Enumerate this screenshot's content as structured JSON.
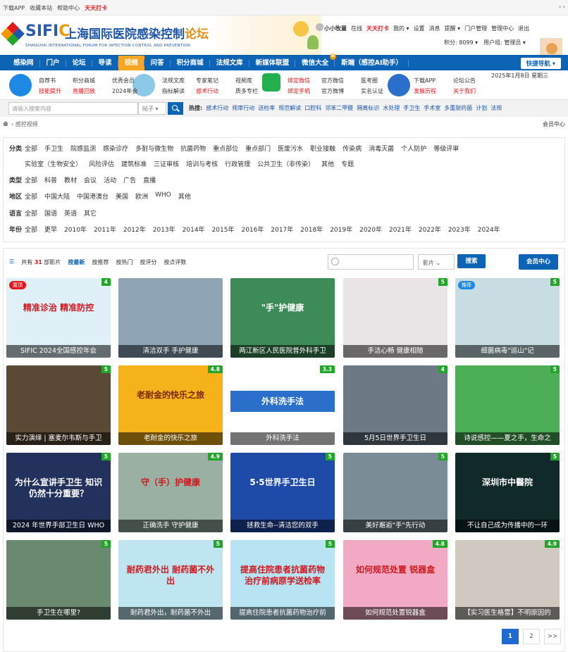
{
  "topbar": {
    "links": [
      "下载APP",
      "收藏本站",
      "帮助中心"
    ],
    "checkin": "天天打卡",
    "arrows": "‹ ›"
  },
  "logo": {
    "brand_a": "SIFI",
    "brand_c": "C",
    "cn_a": "上海国际医院感染控制",
    "cn_b": "论坛",
    "en": "SHANGHAI INTERNATIONAL FORUM FOR INFECTION CONTROL AND PREVENTION"
  },
  "user": {
    "name": "小小牧童",
    "online": "在线",
    "checkin": "天天打卡",
    "links": [
      "我的 ▾",
      "设置",
      "消息",
      "提醒 ▾",
      "门户管理",
      "管理中心",
      "退出"
    ],
    "points": "积分: 8099 ▾",
    "group": "用户组: 管理员 ▾"
  },
  "nav": {
    "items": [
      "感染网",
      "门户",
      "论坛",
      "导读",
      "视频",
      "问答",
      "积分商城",
      "法规文库",
      "新媒体联盟",
      "微信大全",
      "斯端（感控AI助手）"
    ],
    "active_index": 4,
    "wechat_badge": "新",
    "quick": "快捷导航 ▾"
  },
  "sub": {
    "group1": [
      [
        "自荐书",
        "积分商城",
        "优秀会员"
      ],
      [
        "技能提升",
        "直播回放",
        "2024年会"
      ]
    ],
    "group2": [
      [
        "法规文库",
        "专家笔记",
        "视频库"
      ],
      [
        "指标解读",
        "感术行动",
        "质多专栏"
      ]
    ],
    "group3": [
      [
        "绑定微信",
        "官方微信",
        "医考圈"
      ],
      [
        "绑定手机",
        "官方微博",
        "实名认证"
      ]
    ],
    "group4": [
      [
        "下载APP",
        "论坛公告"
      ],
      [
        "发展历程",
        "关于我们"
      ]
    ],
    "date": "2025年1月8日 星期三"
  },
  "search": {
    "placeholder": "请输入搜索内容",
    "select": "帖子 ▾",
    "hot_label": "热搜:",
    "hot": [
      "感术行动",
      "规审行动",
      "送检率",
      "规范解读",
      "口腔科",
      "邻苯二甲醛",
      "隔离标识",
      "水处理",
      "手卫生",
      "手术室",
      "多重耐药菌",
      "计划",
      "法规"
    ]
  },
  "breadcrumb": {
    "path": "› 感控视频",
    "vip": "会员中心"
  },
  "filters": {
    "rows": [
      {
        "label": "分类",
        "items": [
          "全部",
          "手卫生",
          "院感监测",
          "感染诊疗",
          "多耐与微生物",
          "抗菌药物",
          "重点部位",
          "重点部门",
          "医废污水",
          "职业接触",
          "传染病",
          "消毒灭菌",
          "个人防护",
          "等级评审"
        ]
      },
      {
        "label": "",
        "items": [
          "实验室（生物安全）",
          "风险评估",
          "建筑标准",
          "三证审核",
          "培训与考核",
          "行政管理",
          "公共卫生（非传染）",
          "其他",
          "专题"
        ]
      },
      {
        "label": "类型",
        "items": [
          "全部",
          "科普",
          "教材",
          "会议",
          "活动",
          "广告",
          "直播"
        ]
      },
      {
        "label": "地区",
        "items": [
          "全部",
          "中国大陆",
          "中国港澳台",
          "美国",
          "欧洲",
          "WHO",
          "其他"
        ]
      },
      {
        "label": "语言",
        "items": [
          "全部",
          "国语",
          "英语",
          "其它"
        ]
      },
      {
        "label": "年份",
        "items": [
          "全部",
          "更早",
          "2010年",
          "2011年",
          "2012年",
          "2013年",
          "2014年",
          "2015年",
          "2016年",
          "2017年",
          "2018年",
          "2019年",
          "2020年",
          "2021年",
          "2022年",
          "2023年",
          "2024年"
        ]
      }
    ]
  },
  "videos_bar": {
    "count_a": "共有",
    "count_n": "31",
    "count_b": "部影片",
    "sorts": [
      "按最新",
      "按推荐",
      "按热门",
      "按评分",
      "按点评数"
    ],
    "select": "影片",
    "search_btn": "搜索",
    "vip_btn": "会员中心"
  },
  "videos": [
    {
      "title": "SIFIC 2024全国感控年会",
      "score": "4",
      "tag": "置顶",
      "tag_color": "#e4171d",
      "overlay": "精准诊治 精准防控",
      "bg": "#dff0f6"
    },
    {
      "title": "清洁双手 手护健康",
      "score": "",
      "tag": "",
      "overlay": "",
      "bg": "#8fa5b5"
    },
    {
      "title": "两江新区人民医院普外科手卫",
      "score": "",
      "tag": "",
      "overlay": "\"手\"护健康",
      "bg": "#3d8c57"
    },
    {
      "title": "手洁心畅 健康相随",
      "score": "5",
      "tag": "",
      "overlay": "",
      "bg": "#e9e4e6"
    },
    {
      "title": "细菌病毒\"巡山\"记",
      "score": "5",
      "tag": "推荐",
      "tag_color": "#1e88e5",
      "overlay": "",
      "bg": "#c7dde2"
    },
    {
      "title": "实力演绎 | 塞麦尔韦斯与手卫",
      "score": "5",
      "tag": "",
      "overlay": "",
      "bg": "#5a4a35"
    },
    {
      "title": "老耐金的快乐之旅",
      "score": "4.8",
      "tag": "",
      "overlay": "老耐金的快乐之旅",
      "bg": "#f5b21a"
    },
    {
      "title": "外科洗手法",
      "score": "3.3",
      "tag": "",
      "overlay": "外科洗手法",
      "bg": "#ffffff"
    },
    {
      "title": "5月5日世界手卫生日",
      "score": "4",
      "tag": "",
      "overlay": "",
      "bg": "#6c7a86"
    },
    {
      "title": "诗说感控——夏之手，生命之",
      "score": "5",
      "tag": "",
      "overlay": "",
      "bg": "#4cae55"
    },
    {
      "title": "2024 年世界手部卫生日 WHO",
      "score": "5",
      "tag": "",
      "overlay": "为什么宣讲手卫生 知识仍然十分重要？",
      "bg": "#23325c"
    },
    {
      "title": "正确洗手 守护健康",
      "score": "4.9",
      "tag": "",
      "overlay": "守（手）护健康",
      "bg": "#9ab0a2"
    },
    {
      "title": "拯救生命--清洁您的双手",
      "score": "5",
      "tag": "",
      "overlay": "5·5世界手卫生日",
      "bg": "#1e4aa8"
    },
    {
      "title": "美好邂逅\"手\"先行动",
      "score": "5",
      "tag": "",
      "overlay": "",
      "bg": "#7a8c95"
    },
    {
      "title": "不让自己成为传播中的一环",
      "score": "5",
      "tag": "",
      "overlay": "深圳市中醫院",
      "bg": "#0f2a28"
    },
    {
      "title": "手卫生在哪里?",
      "score": "5",
      "tag": "",
      "overlay": "",
      "bg": "#6a8a70"
    },
    {
      "title": "耐药君外出，耐药菌不外出",
      "score": "5",
      "tag": "",
      "overlay": "耐药君外出 耐药菌不外出",
      "bg": "#bfe6f0"
    },
    {
      "title": "提高住院患者抗菌药物治疗前",
      "score": "5",
      "tag": "",
      "overlay": "提高住院患者抗菌药物 治疗前病原学送检率",
      "bg": "#b7e3f2"
    },
    {
      "title": "如何规范处置锐器盒",
      "score": "4.8",
      "tag": "",
      "overlay": "如何规范处置 锐器盒",
      "bg": "#f2a9c4"
    },
    {
      "title": "【实习医生格雷】不明原因的",
      "score": "4.9",
      "tag": "",
      "overlay": "",
      "bg": "#cfc9c0"
    }
  ],
  "pager": [
    "1",
    "2",
    ">>"
  ]
}
